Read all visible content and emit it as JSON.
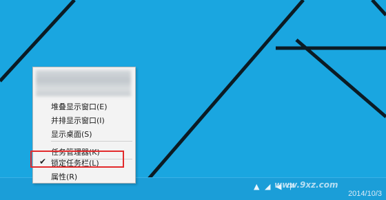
{
  "desktop": {
    "background_color": "#1aa6e0",
    "line_color": "#0b1b24"
  },
  "context_menu": {
    "items": [
      {
        "label": "堆叠显示窗口(E)",
        "checked": false
      },
      {
        "label": "并排显示窗口(I)",
        "checked": false
      },
      {
        "label": "显示桌面(S)",
        "checked": false
      },
      {
        "label": "任务管理器(K)",
        "checked": false
      },
      {
        "label": "锁定任务栏(L)",
        "checked": true
      },
      {
        "label": "属性(R)",
        "checked": false
      }
    ],
    "check_glyph": "✔"
  },
  "highlight": {
    "color": "#e3292a"
  },
  "taskbar": {
    "clock_time": "",
    "clock_date": "2014/10/3",
    "watermark": "www.9xz.com",
    "tray_icons": [
      "up-arrow-icon",
      "network-icon",
      "volume-icon",
      "input-method-icon"
    ]
  }
}
